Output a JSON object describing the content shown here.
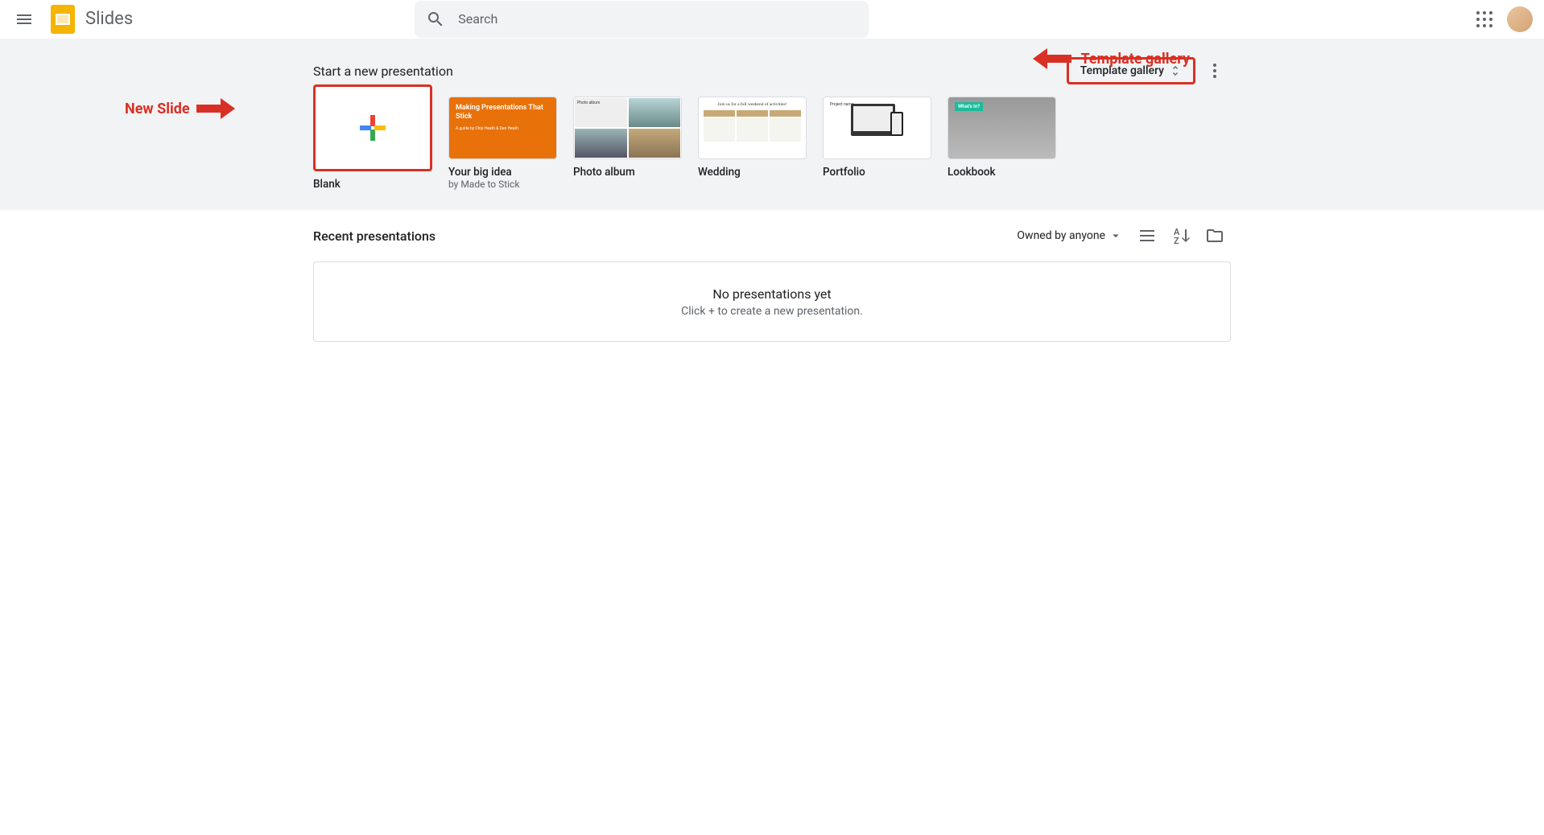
{
  "header": {
    "app_title": "Slides",
    "search_placeholder": "Search"
  },
  "annotations": {
    "new_slide": "New Slide",
    "template_gallery": "Template gallery"
  },
  "templates": {
    "section_title": "Start a new presentation",
    "gallery_button": "Template gallery",
    "items": [
      {
        "name": "Blank",
        "subtitle": ""
      },
      {
        "name": "Your big idea",
        "subtitle": "by Made to Stick"
      },
      {
        "name": "Photo album",
        "subtitle": ""
      },
      {
        "name": "Wedding",
        "subtitle": ""
      },
      {
        "name": "Portfolio",
        "subtitle": ""
      },
      {
        "name": "Lookbook",
        "subtitle": ""
      }
    ],
    "thumb_big_idea_title": "Making Presentations That Stick",
    "thumb_big_idea_sub": "A guide by Chip Heath & Dan Heath",
    "thumb_wedding_header": "Join us for a full weekend of activities!",
    "thumb_portfolio_label": "Project name",
    "thumb_lookbook_label": "What's In?"
  },
  "recent": {
    "title": "Recent presentations",
    "owned_by": "Owned by anyone",
    "empty_title": "No presentations yet",
    "empty_subtitle": "Click + to create a new presentation."
  }
}
